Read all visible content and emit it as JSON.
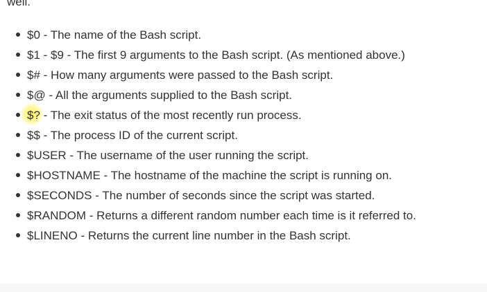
{
  "partial_line": "well.",
  "items": [
    {
      "name": "$0",
      "desc": " - The name of the Bash script."
    },
    {
      "name": "$1 - $9",
      "desc": " - The first 9 arguments to the Bash script. (As mentioned above.)"
    },
    {
      "name": "$#",
      "desc": " - How many arguments were passed to the Bash script."
    },
    {
      "name": "$@",
      "desc": " - All the arguments supplied to the Bash script."
    },
    {
      "name": "$?",
      "desc": " - The exit status of the most recently run process."
    },
    {
      "name": "$$",
      "desc": " - The process ID of the current script."
    },
    {
      "name": "$USER",
      "desc": " - The username of the user running the script."
    },
    {
      "name": "$HOSTNAME",
      "desc": " - The hostname of the machine the script is running on."
    },
    {
      "name": "$SECONDS",
      "desc": " - The number of seconds since the script was started."
    },
    {
      "name": "$RANDOM",
      "desc": " - Returns a different random number each time is it referred to."
    },
    {
      "name": "$LINENO",
      "desc": " - Returns the current line number in the Bash script."
    }
  ],
  "colors": {
    "text": "#333333",
    "highlight": "#fff050",
    "background": "#ffffff"
  }
}
